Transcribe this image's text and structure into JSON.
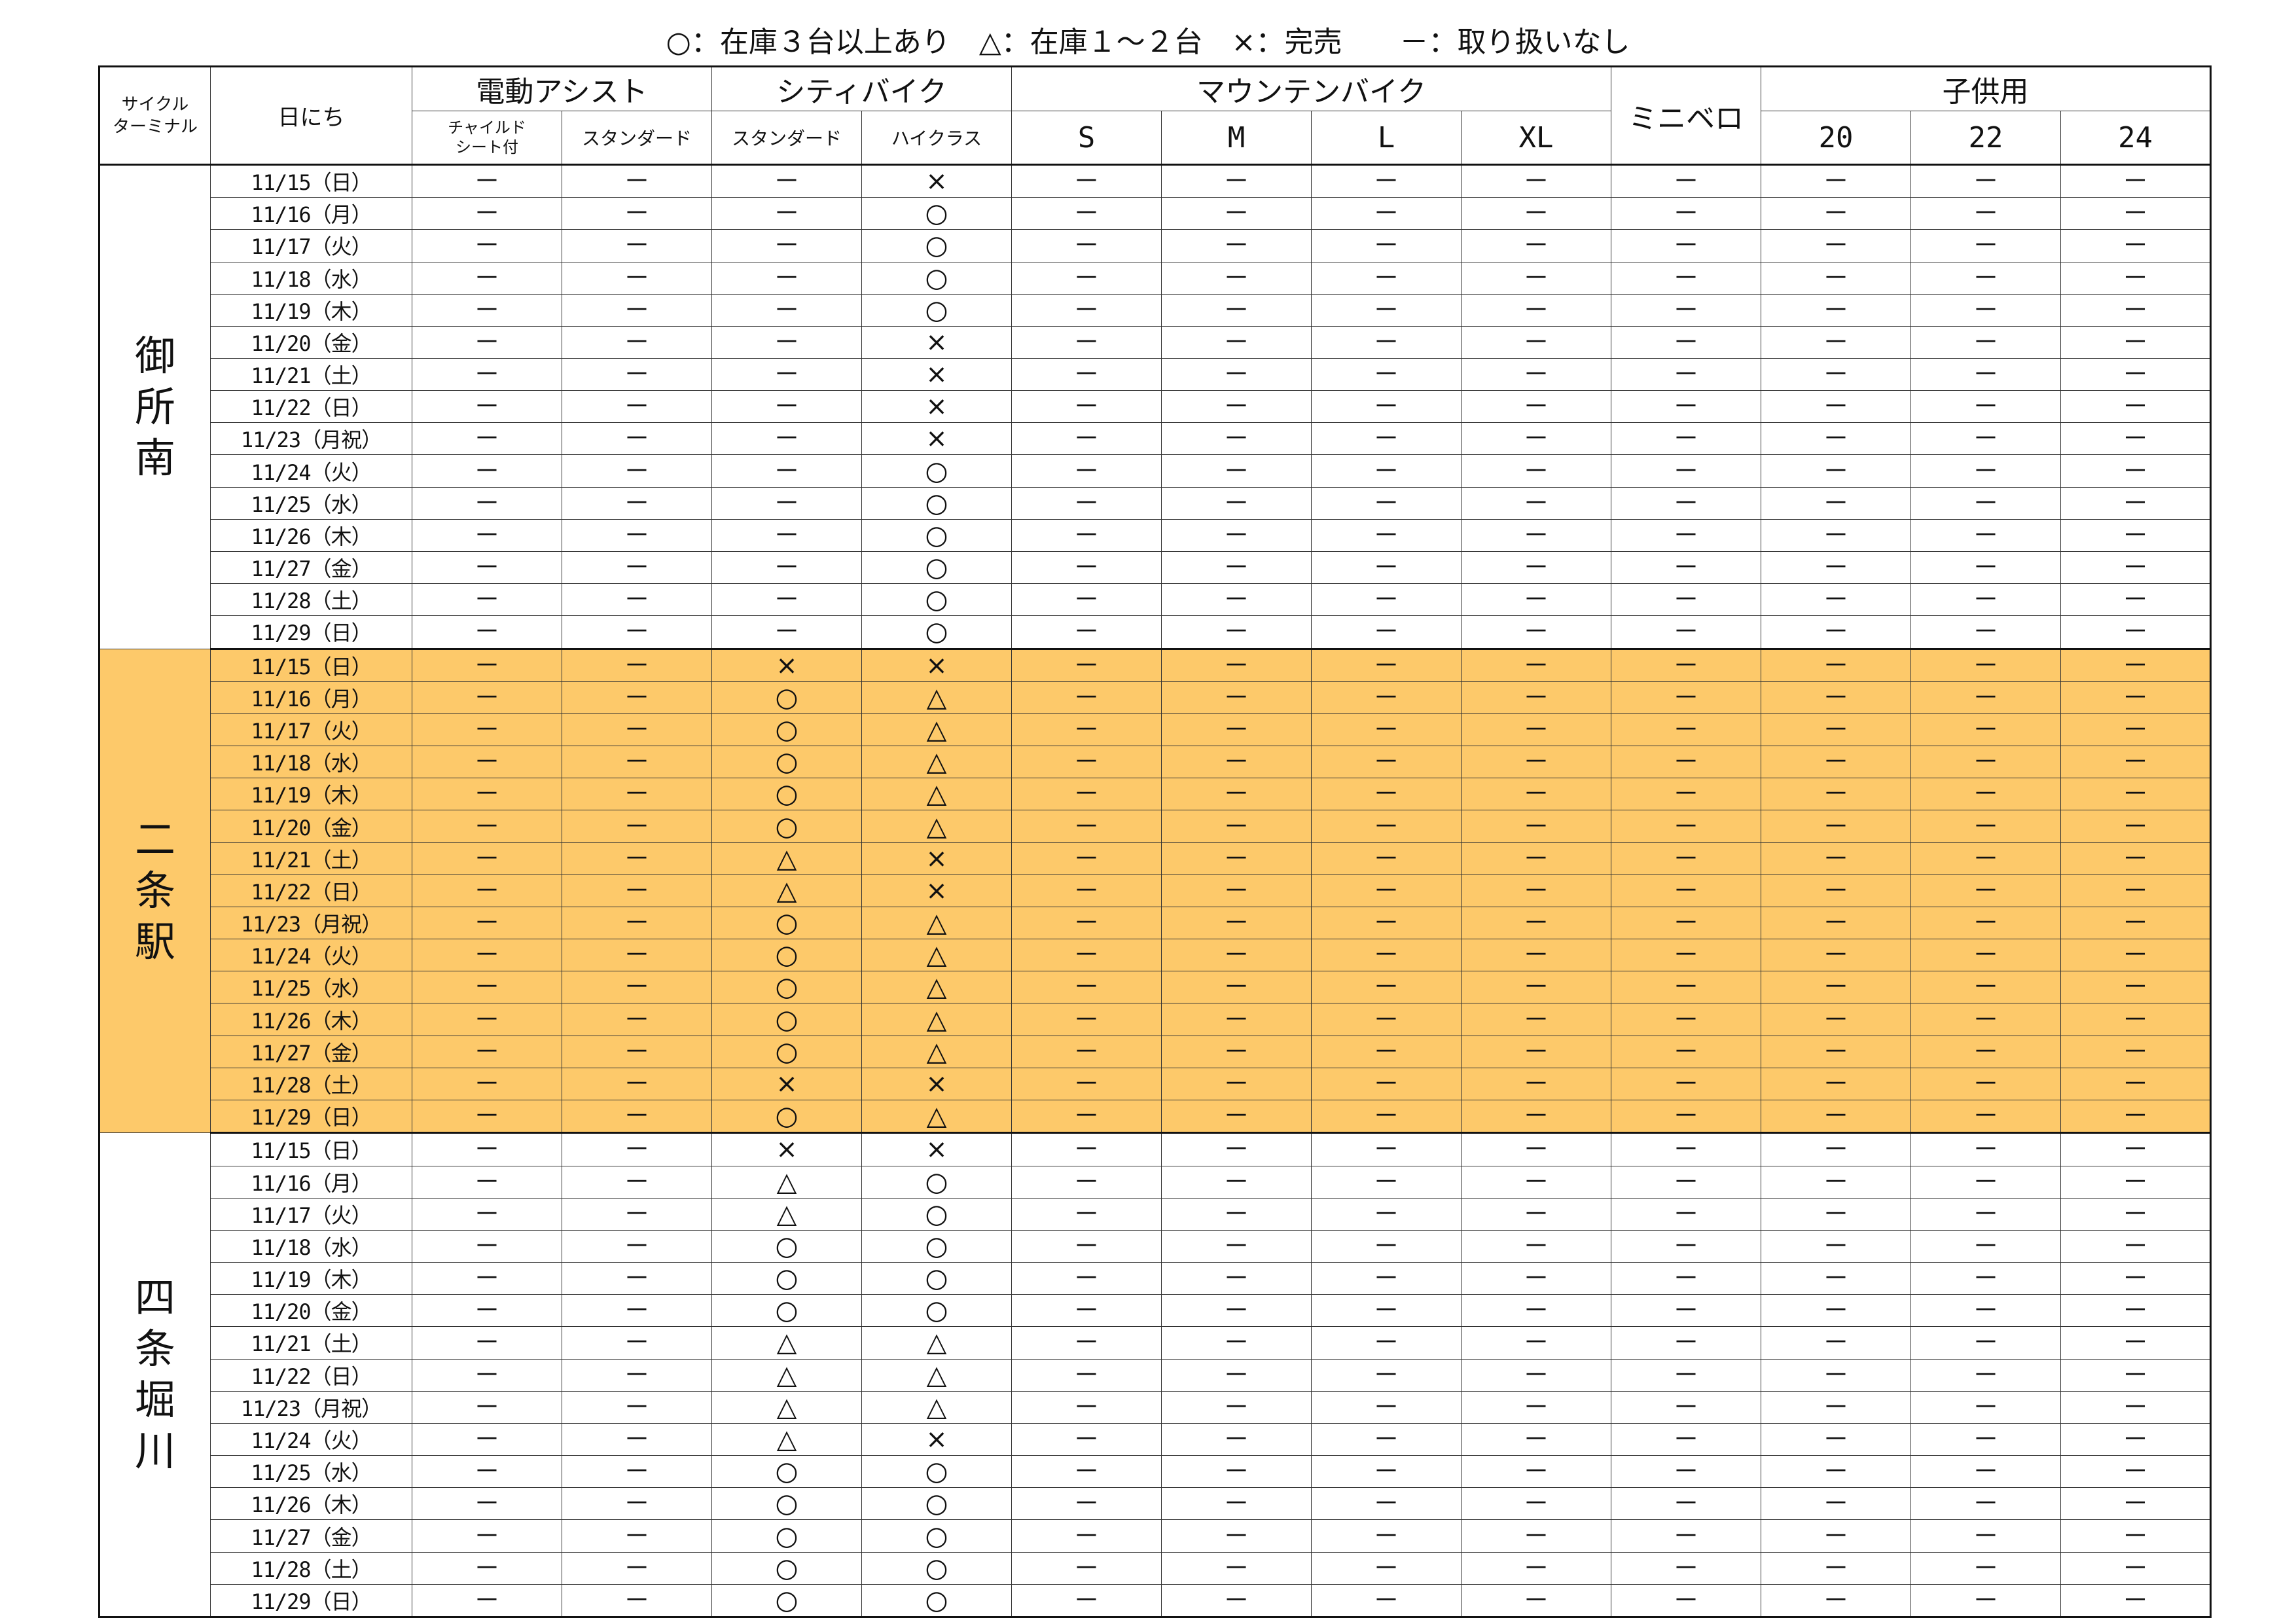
{
  "legend": "○：在庫３台以上あり　△：在庫１～２台　×：完売　　－：取り扱いなし",
  "header": {
    "terminal": "サイクル\nターミナル",
    "date": "日にち",
    "groups": [
      {
        "label": "電動アシスト",
        "subs": [
          "チャイルド\nシート付",
          "スタンダード"
        ]
      },
      {
        "label": "シティバイク",
        "subs": [
          "スタンダード",
          "ハイクラス"
        ]
      },
      {
        "label": "マウンテンバイク",
        "subs": [
          "S",
          "M",
          "L",
          "XL"
        ]
      },
      {
        "label": "ミニベロ",
        "subs": []
      },
      {
        "label": "子供用",
        "subs": [
          "20",
          "22",
          "24"
        ]
      }
    ]
  },
  "dates": [
    "11/15（日）",
    "11/16（月）",
    "11/17（火）",
    "11/18（水）",
    "11/19（木）",
    "11/20（金）",
    "11/21（土）",
    "11/22（日）",
    "11/23（月祝）",
    "11/24（火）",
    "11/25（水）",
    "11/26（木）",
    "11/27（金）",
    "11/28（土）",
    "11/29（日）"
  ],
  "terminals": [
    {
      "name": "御所南",
      "highlight": false,
      "rows": [
        [
          "－",
          "－",
          "－",
          "×",
          "－",
          "－",
          "－",
          "－",
          "－",
          "－",
          "－",
          "－"
        ],
        [
          "－",
          "－",
          "－",
          "○",
          "－",
          "－",
          "－",
          "－",
          "－",
          "－",
          "－",
          "－"
        ],
        [
          "－",
          "－",
          "－",
          "○",
          "－",
          "－",
          "－",
          "－",
          "－",
          "－",
          "－",
          "－"
        ],
        [
          "－",
          "－",
          "－",
          "○",
          "－",
          "－",
          "－",
          "－",
          "－",
          "－",
          "－",
          "－"
        ],
        [
          "－",
          "－",
          "－",
          "○",
          "－",
          "－",
          "－",
          "－",
          "－",
          "－",
          "－",
          "－"
        ],
        [
          "－",
          "－",
          "－",
          "×",
          "－",
          "－",
          "－",
          "－",
          "－",
          "－",
          "－",
          "－"
        ],
        [
          "－",
          "－",
          "－",
          "×",
          "－",
          "－",
          "－",
          "－",
          "－",
          "－",
          "－",
          "－"
        ],
        [
          "－",
          "－",
          "－",
          "×",
          "－",
          "－",
          "－",
          "－",
          "－",
          "－",
          "－",
          "－"
        ],
        [
          "－",
          "－",
          "－",
          "×",
          "－",
          "－",
          "－",
          "－",
          "－",
          "－",
          "－",
          "－"
        ],
        [
          "－",
          "－",
          "－",
          "○",
          "－",
          "－",
          "－",
          "－",
          "－",
          "－",
          "－",
          "－"
        ],
        [
          "－",
          "－",
          "－",
          "○",
          "－",
          "－",
          "－",
          "－",
          "－",
          "－",
          "－",
          "－"
        ],
        [
          "－",
          "－",
          "－",
          "○",
          "－",
          "－",
          "－",
          "－",
          "－",
          "－",
          "－",
          "－"
        ],
        [
          "－",
          "－",
          "－",
          "○",
          "－",
          "－",
          "－",
          "－",
          "－",
          "－",
          "－",
          "－"
        ],
        [
          "－",
          "－",
          "－",
          "○",
          "－",
          "－",
          "－",
          "－",
          "－",
          "－",
          "－",
          "－"
        ],
        [
          "－",
          "－",
          "－",
          "○",
          "－",
          "－",
          "－",
          "－",
          "－",
          "－",
          "－",
          "－"
        ]
      ]
    },
    {
      "name": "二条駅",
      "highlight": true,
      "rows": [
        [
          "－",
          "－",
          "×",
          "×",
          "－",
          "－",
          "－",
          "－",
          "－",
          "－",
          "－",
          "－"
        ],
        [
          "－",
          "－",
          "○",
          "△",
          "－",
          "－",
          "－",
          "－",
          "－",
          "－",
          "－",
          "－"
        ],
        [
          "－",
          "－",
          "○",
          "△",
          "－",
          "－",
          "－",
          "－",
          "－",
          "－",
          "－",
          "－"
        ],
        [
          "－",
          "－",
          "○",
          "△",
          "－",
          "－",
          "－",
          "－",
          "－",
          "－",
          "－",
          "－"
        ],
        [
          "－",
          "－",
          "○",
          "△",
          "－",
          "－",
          "－",
          "－",
          "－",
          "－",
          "－",
          "－"
        ],
        [
          "－",
          "－",
          "○",
          "△",
          "－",
          "－",
          "－",
          "－",
          "－",
          "－",
          "－",
          "－"
        ],
        [
          "－",
          "－",
          "△",
          "×",
          "－",
          "－",
          "－",
          "－",
          "－",
          "－",
          "－",
          "－"
        ],
        [
          "－",
          "－",
          "△",
          "×",
          "－",
          "－",
          "－",
          "－",
          "－",
          "－",
          "－",
          "－"
        ],
        [
          "－",
          "－",
          "○",
          "△",
          "－",
          "－",
          "－",
          "－",
          "－",
          "－",
          "－",
          "－"
        ],
        [
          "－",
          "－",
          "○",
          "△",
          "－",
          "－",
          "－",
          "－",
          "－",
          "－",
          "－",
          "－"
        ],
        [
          "－",
          "－",
          "○",
          "△",
          "－",
          "－",
          "－",
          "－",
          "－",
          "－",
          "－",
          "－"
        ],
        [
          "－",
          "－",
          "○",
          "△",
          "－",
          "－",
          "－",
          "－",
          "－",
          "－",
          "－",
          "－"
        ],
        [
          "－",
          "－",
          "○",
          "△",
          "－",
          "－",
          "－",
          "－",
          "－",
          "－",
          "－",
          "－"
        ],
        [
          "－",
          "－",
          "×",
          "×",
          "－",
          "－",
          "－",
          "－",
          "－",
          "－",
          "－",
          "－"
        ],
        [
          "－",
          "－",
          "○",
          "△",
          "－",
          "－",
          "－",
          "－",
          "－",
          "－",
          "－",
          "－"
        ]
      ]
    },
    {
      "name": "四条堀川",
      "highlight": false,
      "rows": [
        [
          "－",
          "－",
          "×",
          "×",
          "－",
          "－",
          "－",
          "－",
          "－",
          "－",
          "－",
          "－"
        ],
        [
          "－",
          "－",
          "△",
          "○",
          "－",
          "－",
          "－",
          "－",
          "－",
          "－",
          "－",
          "－"
        ],
        [
          "－",
          "－",
          "△",
          "○",
          "－",
          "－",
          "－",
          "－",
          "－",
          "－",
          "－",
          "－"
        ],
        [
          "－",
          "－",
          "○",
          "○",
          "－",
          "－",
          "－",
          "－",
          "－",
          "－",
          "－",
          "－"
        ],
        [
          "－",
          "－",
          "○",
          "○",
          "－",
          "－",
          "－",
          "－",
          "－",
          "－",
          "－",
          "－"
        ],
        [
          "－",
          "－",
          "○",
          "○",
          "－",
          "－",
          "－",
          "－",
          "－",
          "－",
          "－",
          "－"
        ],
        [
          "－",
          "－",
          "△",
          "△",
          "－",
          "－",
          "－",
          "－",
          "－",
          "－",
          "－",
          "－"
        ],
        [
          "－",
          "－",
          "△",
          "△",
          "－",
          "－",
          "－",
          "－",
          "－",
          "－",
          "－",
          "－"
        ],
        [
          "－",
          "－",
          "△",
          "△",
          "－",
          "－",
          "－",
          "－",
          "－",
          "－",
          "－",
          "－"
        ],
        [
          "－",
          "－",
          "△",
          "×",
          "－",
          "－",
          "－",
          "－",
          "－",
          "－",
          "－",
          "－"
        ],
        [
          "－",
          "－",
          "○",
          "○",
          "－",
          "－",
          "－",
          "－",
          "－",
          "－",
          "－",
          "－"
        ],
        [
          "－",
          "－",
          "○",
          "○",
          "－",
          "－",
          "－",
          "－",
          "－",
          "－",
          "－",
          "－"
        ],
        [
          "－",
          "－",
          "○",
          "○",
          "－",
          "－",
          "－",
          "－",
          "－",
          "－",
          "－",
          "－"
        ],
        [
          "－",
          "－",
          "○",
          "○",
          "－",
          "－",
          "－",
          "－",
          "－",
          "－",
          "－",
          "－"
        ],
        [
          "－",
          "－",
          "○",
          "○",
          "－",
          "－",
          "－",
          "－",
          "－",
          "－",
          "－",
          "－"
        ]
      ]
    }
  ],
  "colors": {
    "highlight": "#fdc96a",
    "border": "#333333"
  }
}
